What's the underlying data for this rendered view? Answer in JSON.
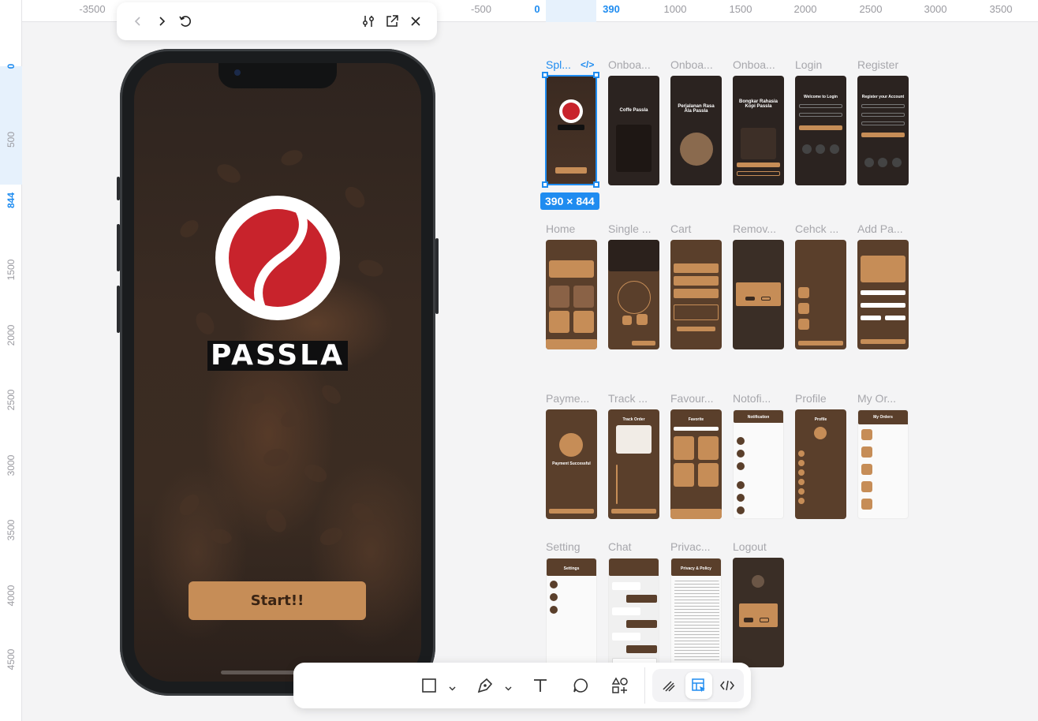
{
  "ruler": {
    "top": [
      "-3500",
      "-500",
      "0",
      "390",
      "1000",
      "1500",
      "2000",
      "2500",
      "3000",
      "3500"
    ],
    "left": [
      "0",
      "500",
      "844",
      "1500",
      "2000",
      "2500",
      "3000",
      "3500",
      "4000",
      "4500"
    ]
  },
  "preview": {
    "app_name": "PASSLA",
    "start_label": "Start!!"
  },
  "frames": [
    {
      "label": "Spl..."
    },
    {
      "label": "Onboa...",
      "title": "Coffe Passla"
    },
    {
      "label": "Onboa...",
      "title": "Perjalanan Rasa Ala Passla"
    },
    {
      "label": "Onboa...",
      "title": "Bongkar Rahasia Kopi Passla"
    },
    {
      "label": "Login",
      "title": "Welcome to Login"
    },
    {
      "label": "Register",
      "title": "Register your Account"
    },
    {
      "label": "Home"
    },
    {
      "label": "Single ..."
    },
    {
      "label": "Cart"
    },
    {
      "label": "Remov..."
    },
    {
      "label": "Cehck ..."
    },
    {
      "label": "Add Pa..."
    },
    {
      "label": "Payme...",
      "title": "Payment Successful"
    },
    {
      "label": "Track ...",
      "title": "Track Order"
    },
    {
      "label": "Favour...",
      "title": "Favorite"
    },
    {
      "label": "Notofi...",
      "title": "Notification"
    },
    {
      "label": "Profile",
      "title": "Profile"
    },
    {
      "label": "My Or...",
      "title": "My Orders"
    },
    {
      "label": "Setting",
      "title": "Settings"
    },
    {
      "label": "Chat"
    },
    {
      "label": "Privac...",
      "title": "Privacy & Policy"
    },
    {
      "label": "Logout"
    }
  ],
  "selection": {
    "size": "390 × 844"
  },
  "colors": {
    "accent": "#1f8cf0",
    "brand_red": "#c8232c",
    "coffee": "#c68d57",
    "dark_brown": "#5a3f2b"
  }
}
